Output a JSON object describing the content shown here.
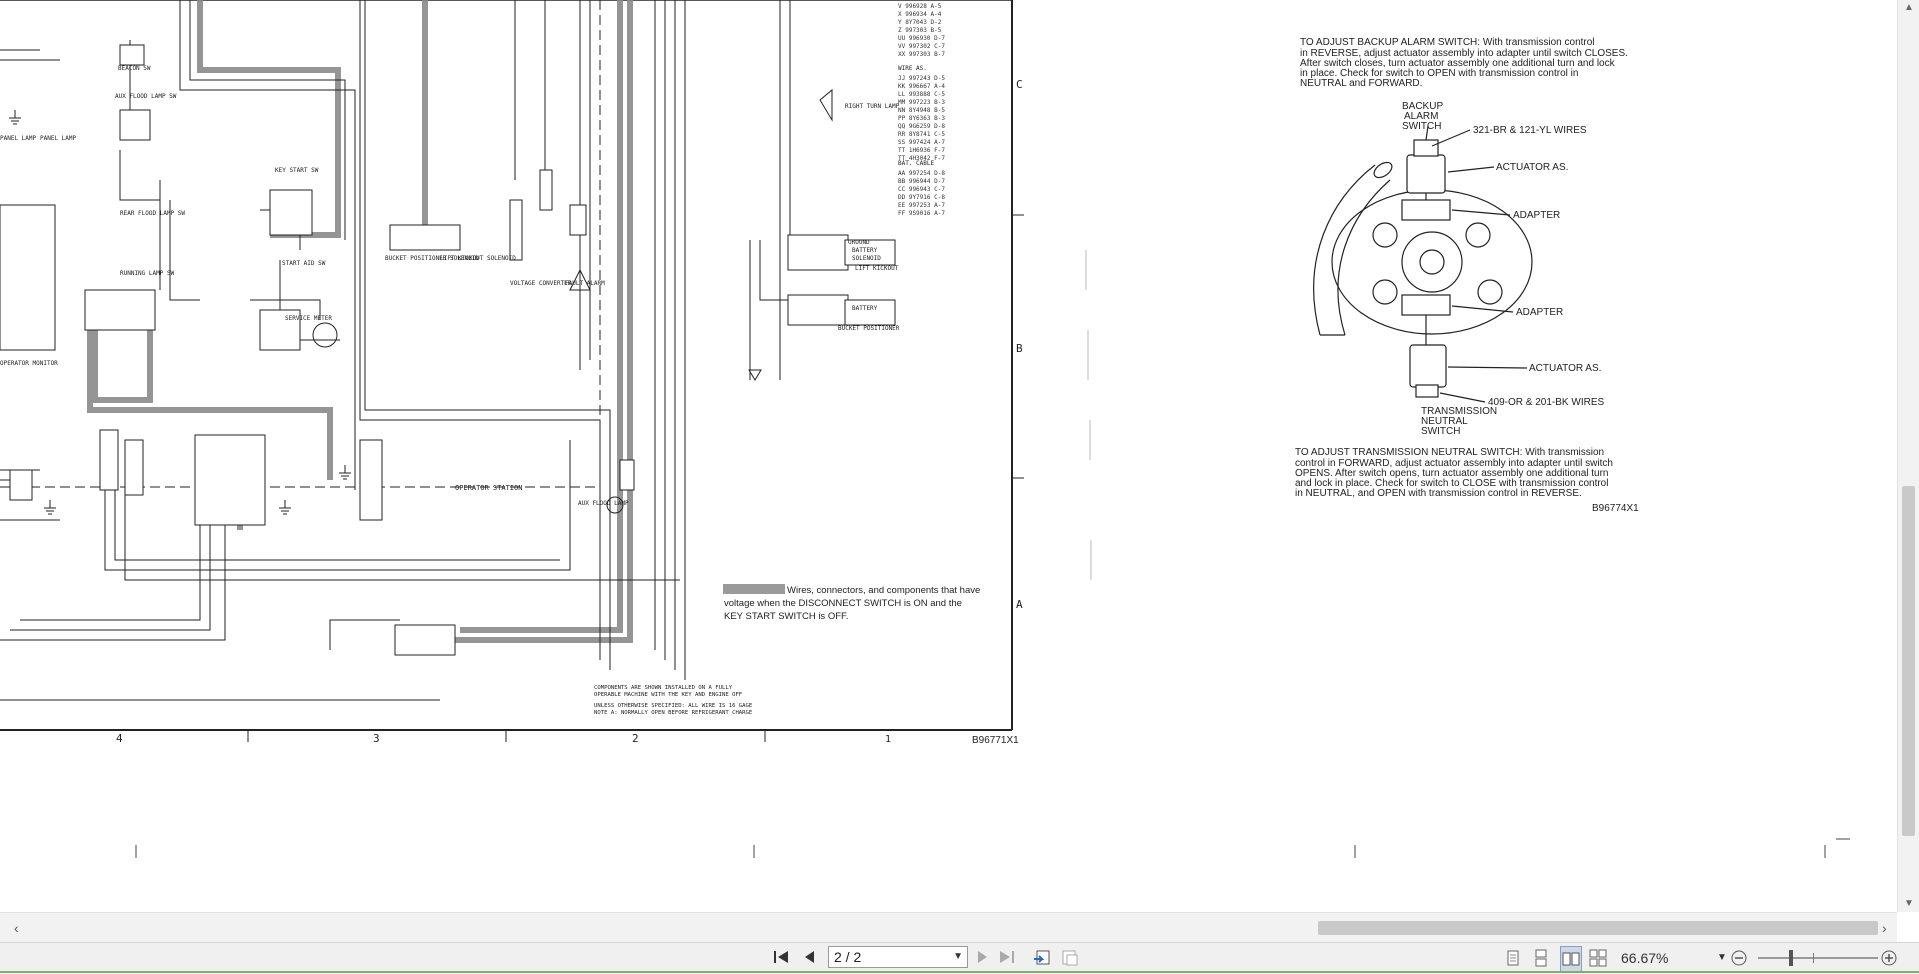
{
  "document": {
    "drawing_number_left": "B96771X1",
    "drawing_number_right": "B96774X1",
    "zone_numbers": [
      "4",
      "3",
      "2",
      "1"
    ],
    "zone_letters": [
      "C",
      "B",
      "A"
    ],
    "legend_text_1": "Wires, connectors, and components that have",
    "legend_text_2": "voltage when the DISCONNECT SWITCH is ON and the",
    "legend_text_3": "KEY START SWITCH is OFF.",
    "note_1a": "COMPONENTS ARE SHOWN INSTALLED ON A FULLY",
    "note_1b": "OPERABLE MACHINE WITH THE KEY AND ENGINE OFF",
    "note_2a": "UNLESS OTHERWISE SPECIFIED: ALL WIRE IS 16 GAGE",
    "note_2b": "NOTE A: NORMALLY OPEN BEFORE REFRIGERANT CHARGE",
    "operator_station": "OPERATOR STATION",
    "labels": {
      "beacon_sw": "BEACON SW",
      "aux_flood_sw": "AUX FLOOD LAMP SW",
      "rear_flood_sw": "REAR FLOOD LAMP SW",
      "running_lamp_sw": "RUNNING LAMP SW",
      "key_start_sw": "KEY START SW",
      "start_aid_sw": "START AID SW",
      "service_meter": "SERVICE METER",
      "bucket_positioner_sol": "BUCKET POSITIONER SOLENOID",
      "lift_kickout_sol": "LIFT KICKOUT SOLENOID",
      "voltage_converter": "VOLTAGE CONVERTER",
      "fault_alarm": "FAULT ALARM",
      "right_turn_lamp": "RIGHT TURN LAMP",
      "lift_kickout": "LIFT KICKOUT",
      "bucket_positioner": "BUCKET POSITIONER",
      "aux_flood_lamp": "AUX FLOOD LAMP",
      "operator_monitor": "OPERATOR MONITOR",
      "wire_as": "WIRE AS.",
      "bat_cable": "BAT. CABLE",
      "battery": "BATTERY",
      "solenoid": "SOLENOID",
      "ground": "GROUND",
      "panel_lamp": "PANEL LAMP"
    }
  },
  "detail": {
    "backup_title": "TO ADJUST BACKUP ALARM SWITCH:",
    "backup_l1": "TO ADJUST BACKUP ALARM SWITCH:  With transmission control",
    "backup_l2": "in REVERSE, adjust actuator assembly into adapter until switch CLOSES.",
    "backup_l3": "After switch closes, turn actuator assembly one additional turn and lock",
    "backup_l4": "in place.  Check for switch to OPEN with transmission control in",
    "backup_l5": "NEUTRAL and FORWARD.",
    "callout_backup_1": "BACKUP",
    "callout_backup_2": "ALARM",
    "callout_backup_3": "SWITCH",
    "callout_wires_top": "321-BR & 121-YL WIRES",
    "callout_actuator_top": "ACTUATOR AS.",
    "callout_adapter_top": "ADAPTER",
    "callout_adapter_bottom": "ADAPTER",
    "callout_actuator_bottom": "ACTUATOR AS.",
    "callout_wires_bottom": "409-OR & 201-BK WIRES",
    "callout_trans_1": "TRANSMISSION",
    "callout_trans_2": "NEUTRAL",
    "callout_trans_3": "SWITCH",
    "neutral_l1": "TO ADJUST TRANSMISSION NEUTRAL SWITCH:  With transmission",
    "neutral_l2": "control in FORWARD, adjust actuator assembly into adapter until switch",
    "neutral_l3": "OPENS.  After switch opens, turn actuator assembly one additional turn",
    "neutral_l4": "and lock in place.  Check for switch to CLOSE with transmission control",
    "neutral_l5": "in NEUTRAL, and OPEN with transmission control in REVERSE."
  },
  "toolbar": {
    "first_page": "first-page",
    "prev_page": "previous-page",
    "page_value": "2 / 2",
    "next_page": "next-page",
    "last_page": "last-page",
    "zoom_value": "66.67%"
  },
  "colors": {
    "ink": "#222222",
    "shade": "#9a9a9a",
    "toolbar_bg": "#f0f0f0",
    "scroll_thumb": "#c9c9c9"
  }
}
